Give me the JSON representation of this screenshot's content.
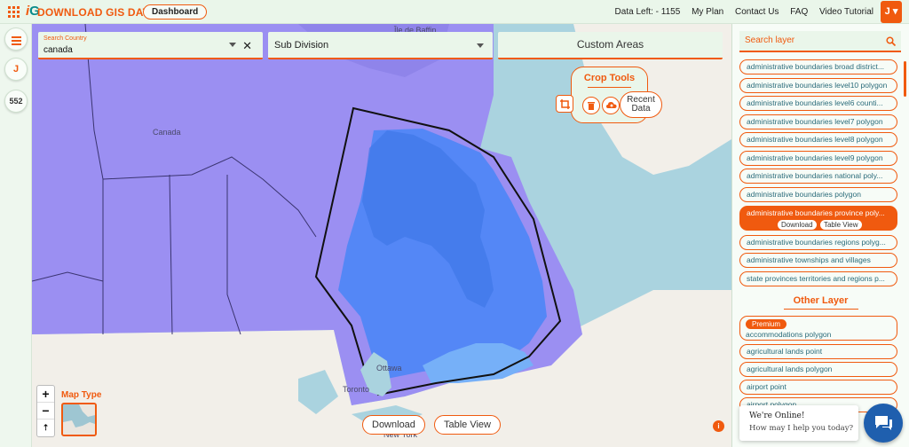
{
  "header": {
    "logo_mark": "iG",
    "logo_text": "DOWNLOAD GIS DATA",
    "dashboard_label": "Dashboard",
    "data_left": "Data Left: - 1155",
    "my_plan": "My Plan",
    "contact_us": "Contact Us",
    "faq": "FAQ",
    "video_tutorial": "Video Tutorial",
    "user_initial": "J ▾"
  },
  "rail": {
    "user_initial": "J",
    "count": "552"
  },
  "search": {
    "country_label": "Search Country",
    "country_value": "canada",
    "clear_glyph": "✕",
    "subdivision_label": "Sub Division",
    "custom_areas_label": "Custom Areas"
  },
  "crop": {
    "title": "Crop Tools",
    "recent_label": "Recent Data"
  },
  "map": {
    "labels": {
      "baffin": "Île de Baffin",
      "canada": "Canada",
      "ottawa": "Ottawa",
      "toronto": "Toronto",
      "newyork": "New York"
    },
    "zoom_in": "+",
    "zoom_out": "−",
    "reset": "⇡",
    "map_type_label": "Map Type",
    "download_label": "Download",
    "table_view_label": "Table View",
    "info_glyph": "i"
  },
  "layers": {
    "search_placeholder": "Search layer",
    "items": [
      "administrative boundaries broad district...",
      "administrative boundaries level10 polygon",
      "administrative boundaries level6 counti...",
      "administrative boundaries level7 polygon",
      "administrative boundaries level8 polygon",
      "administrative boundaries level9 polygon",
      "administrative boundaries national poly...",
      "administrative boundaries polygon"
    ],
    "active": {
      "name": "administrative boundaries province poly...",
      "download": "Download",
      "table_view": "Table View"
    },
    "items_after": [
      "administrative boundaries regions polyg...",
      "administrative townships and villages",
      "state provinces territories and regions p..."
    ],
    "other_title": "Other Layer",
    "premium_badge": "Premium",
    "premium_item": "accommodations polygon",
    "other_items": [
      "agricultural lands point",
      "agricultural lands polygon",
      "airport point",
      "airport polygon"
    ]
  },
  "chat": {
    "title": "We're Online!",
    "subtitle": "How may I help you today?"
  },
  "colors": {
    "accent": "#f05a0f",
    "province": "#9b8ff2",
    "selected": "#4c86f6",
    "water": "#aad3df"
  }
}
